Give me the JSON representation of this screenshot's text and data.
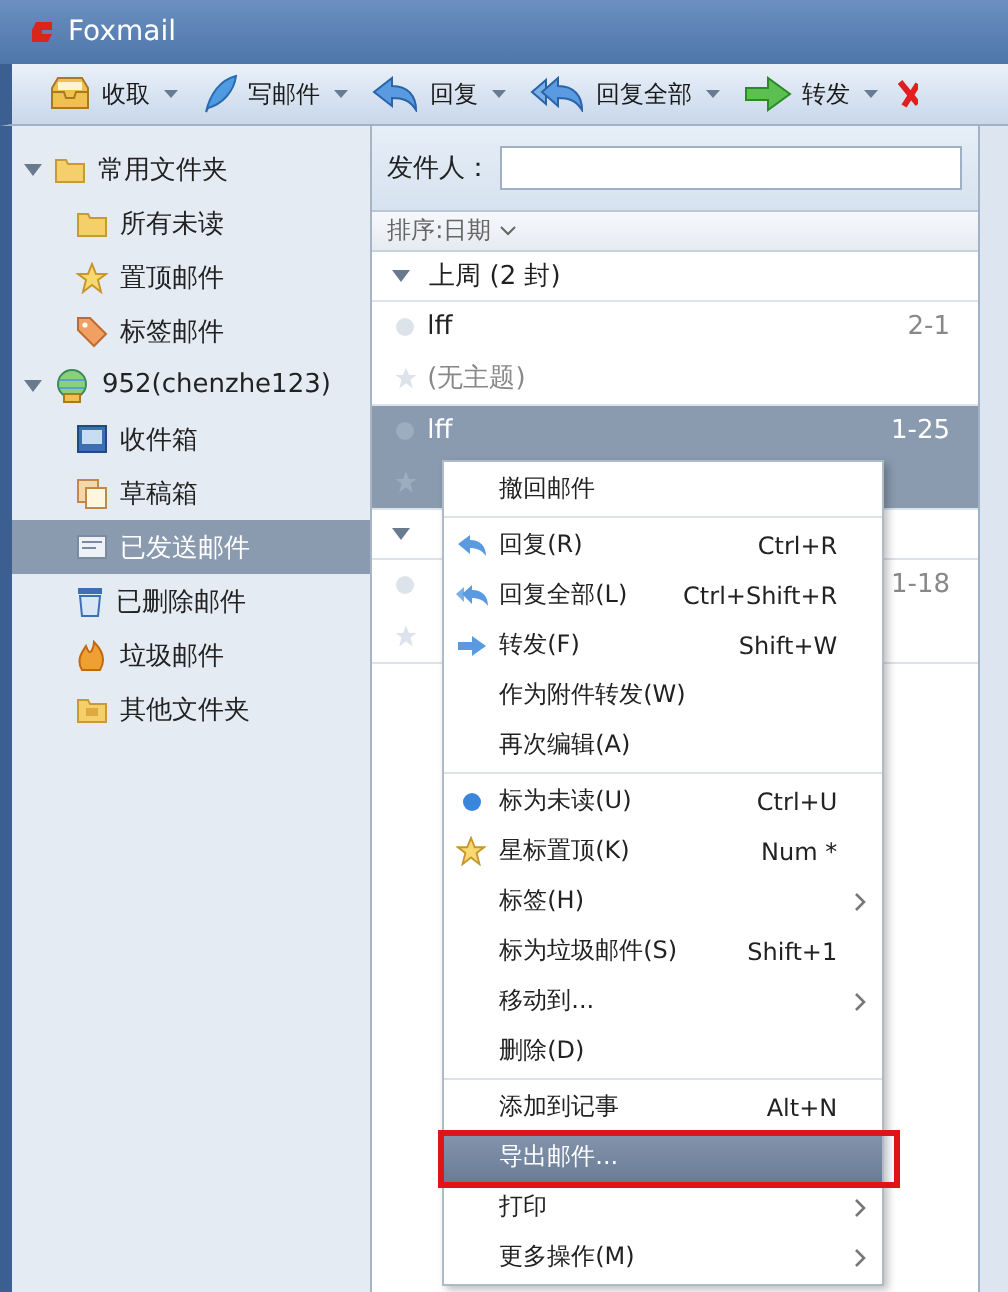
{
  "window": {
    "title": "Foxmail"
  },
  "toolbar": [
    {
      "label": "收取"
    },
    {
      "label": "写邮件"
    },
    {
      "label": "回复"
    },
    {
      "label": "回复全部"
    },
    {
      "label": "转发"
    }
  ],
  "sidebar": {
    "groups": [
      {
        "label": "常用文件夹",
        "expanded": true,
        "children": [
          {
            "label": "所有未读",
            "selected": false
          },
          {
            "label": "置顶邮件",
            "selected": false
          },
          {
            "label": "标签邮件",
            "selected": false
          }
        ]
      },
      {
        "label": "952(chenzhe123)",
        "expanded": true,
        "children": [
          {
            "label": "收件箱",
            "selected": false
          },
          {
            "label": "草稿箱",
            "selected": false
          },
          {
            "label": "已发送邮件",
            "selected": true
          },
          {
            "label": "已删除邮件",
            "selected": false
          },
          {
            "label": "垃圾邮件",
            "selected": false
          },
          {
            "label": "其他文件夹",
            "selected": false
          }
        ]
      }
    ]
  },
  "mail_list": {
    "search": {
      "label": "发件人："
    },
    "sort": "排序:日期",
    "groups": [
      {
        "label": "上周 (2 封)",
        "expanded": true,
        "mails": [
          {
            "sender": "lff",
            "date": "2-1",
            "subject": "(无主题)",
            "selected": false
          },
          {
            "sender": "lff",
            "date": "1-25",
            "selected": true
          }
        ]
      },
      {
        "expanded": true,
        "mails": [
          {
            "date": "1-18",
            "selected": false
          }
        ]
      }
    ]
  },
  "context_menu": {
    "items": [
      {
        "kind": "item",
        "label": "撤回邮件",
        "selected": false
      },
      {
        "kind": "separator"
      },
      {
        "kind": "item",
        "label": "回复(R)",
        "shortcut": "Ctrl+R",
        "selected": false
      },
      {
        "kind": "item",
        "label": "回复全部(L)",
        "shortcut": "Ctrl+Shift+R",
        "selected": false
      },
      {
        "kind": "item",
        "label": "转发(F)",
        "shortcut": "Shift+W",
        "selected": false
      },
      {
        "kind": "item",
        "label": "作为附件转发(W)",
        "selected": false
      },
      {
        "kind": "item",
        "label": "再次编辑(A)",
        "selected": false
      },
      {
        "kind": "separator"
      },
      {
        "kind": "item",
        "label": "标为未读(U)",
        "shortcut": "Ctrl+U",
        "selected": false
      },
      {
        "kind": "item",
        "label": "星标置顶(K)",
        "shortcut": "Num *",
        "selected": false
      },
      {
        "kind": "item",
        "label": "标签(H)",
        "submenu": true,
        "selected": false
      },
      {
        "kind": "item",
        "label": "标为垃圾邮件(S)",
        "shortcut": "Shift+1",
        "selected": false
      },
      {
        "kind": "item",
        "label": "移动到...",
        "submenu": true,
        "selected": false
      },
      {
        "kind": "item",
        "label": "删除(D)",
        "selected": false
      },
      {
        "kind": "separator"
      },
      {
        "kind": "item",
        "label": "添加到记事",
        "shortcut": "Alt+N",
        "selected": false
      },
      {
        "kind": "item",
        "label": "导出邮件...",
        "selected": true
      },
      {
        "kind": "item",
        "label": "打印",
        "submenu": true,
        "selected": false
      },
      {
        "kind": "item",
        "label": "更多操作(M)",
        "submenu": true,
        "selected": false
      }
    ]
  }
}
